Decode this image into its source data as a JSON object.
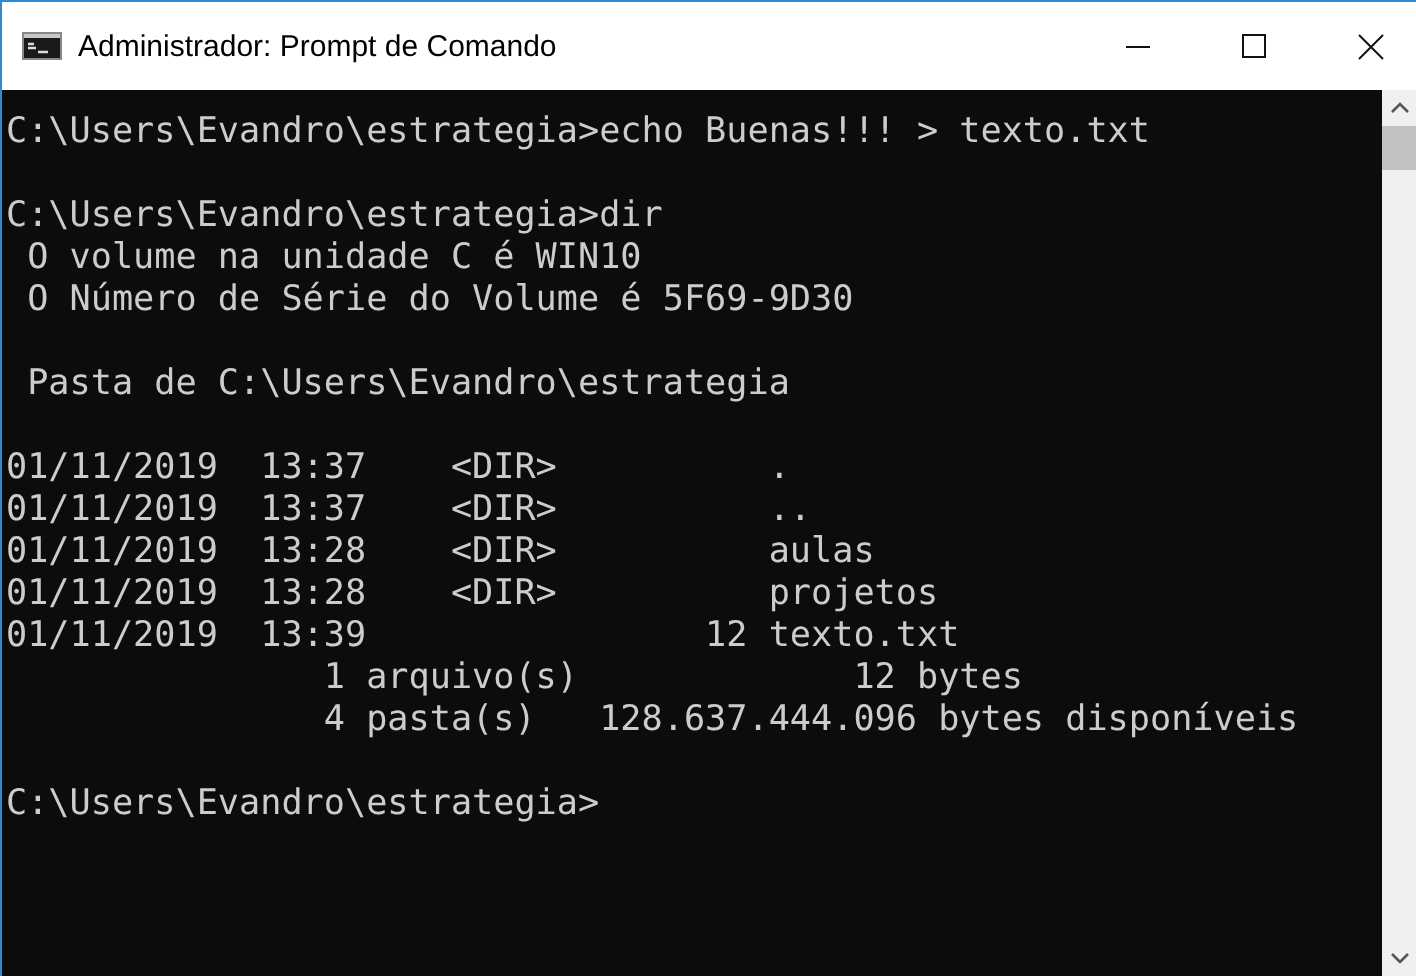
{
  "window": {
    "title": "Administrador: Prompt de Comando"
  },
  "console": {
    "blocks": [
      {
        "lines": [
          "C:\\Users\\Evandro\\estrategia>echo Buenas!!! > texto.txt"
        ]
      },
      {
        "lines": [
          "C:\\Users\\Evandro\\estrategia>dir",
          " O volume na unidade C é WIN10",
          " O Número de Série do Volume é 5F69-9D30"
        ]
      },
      {
        "lines": [
          " Pasta de C:\\Users\\Evandro\\estrategia"
        ]
      },
      {
        "lines": [
          "01/11/2019  13:37    <DIR>          .",
          "01/11/2019  13:37    <DIR>          ..",
          "01/11/2019  13:28    <DIR>          aulas",
          "01/11/2019  13:28    <DIR>          projetos",
          "01/11/2019  13:39                12 texto.txt",
          "               1 arquivo(s)             12 bytes",
          "               4 pasta(s)   128.637.444.096 bytes disponíveis"
        ]
      },
      {
        "lines": [
          "C:\\Users\\Evandro\\estrategia>"
        ]
      }
    ]
  }
}
